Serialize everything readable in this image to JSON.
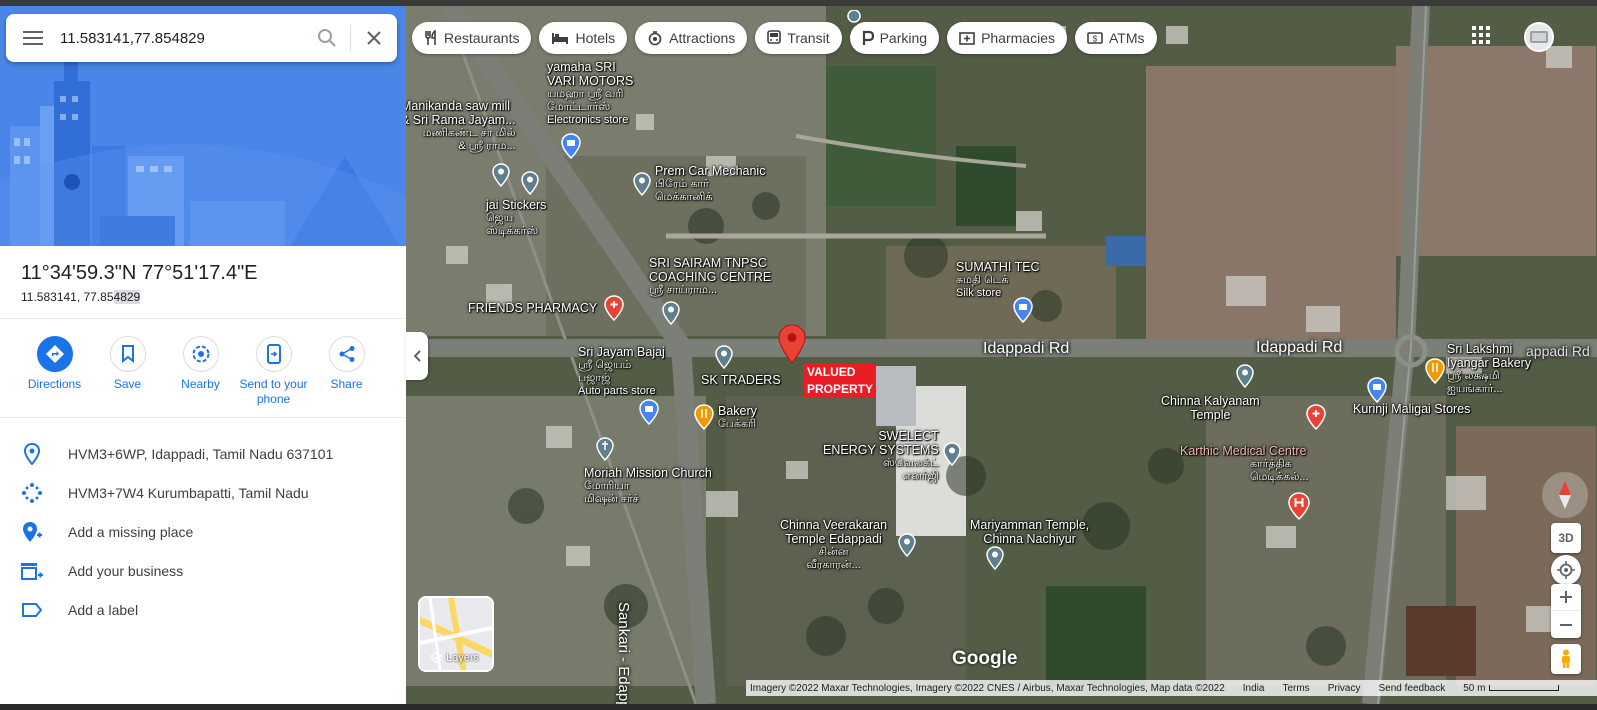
{
  "search": {
    "value": "11.583141,77.854829"
  },
  "place": {
    "dms": "11°34'59.3\"N 77°51'17.4\"E",
    "decimal_plain": "11.583141, 77.85",
    "decimal_highlight": "4829"
  },
  "actions": [
    {
      "label": "Directions",
      "icon": "directions-icon"
    },
    {
      "label": "Save",
      "icon": "bookmark-icon"
    },
    {
      "label": "Nearby",
      "icon": "nearby-icon"
    },
    {
      "label": "Send to your phone",
      "icon": "phone-icon"
    },
    {
      "label": "Share",
      "icon": "share-icon"
    }
  ],
  "info_rows": [
    {
      "text": "HVM3+6WP, Idappadi, Tamil Nadu 637101",
      "icon": "location-pin-icon"
    },
    {
      "text": "HVM3+7W4 Kurumbapatti, Tamil Nadu",
      "icon": "plus-code-icon"
    },
    {
      "text": "Add a missing place",
      "icon": "add-place-icon"
    },
    {
      "text": "Add your business",
      "icon": "add-business-icon"
    },
    {
      "text": "Add a label",
      "icon": "label-icon"
    }
  ],
  "chips": [
    {
      "label": "Restaurants",
      "icon": "fork-knife-icon"
    },
    {
      "label": "Hotels",
      "icon": "bed-icon"
    },
    {
      "label": "Attractions",
      "icon": "attraction-icon"
    },
    {
      "label": "Transit",
      "icon": "bus-icon"
    },
    {
      "label": "Parking",
      "icon": "parking-icon"
    },
    {
      "label": "Pharmacies",
      "icon": "pharmacy-icon"
    },
    {
      "label": "ATMs",
      "icon": "atm-icon"
    }
  ],
  "map_labels": {
    "yamaha": {
      "name": "yamaha SRI\nVARI MOTORS",
      "tamil": "யமஹா ஸ்ரீ வரி\nமோட்டார்ஸ்",
      "type": "Electronics store"
    },
    "manikanda": {
      "name": "Manikanda saw mill\n& Sri Rama Jayam...",
      "tamil": "மணிகண்ட சா மில்\n& ஸ்ரீ ராம..."
    },
    "prem": {
      "name": "Prem Car Mechanic",
      "tamil": "பிரேம் கார்\nமெக்கானிக்"
    },
    "jai": {
      "name": "jai Stickers",
      "tamil": "ஜெய\nஸ்டிக்கர்ஸ்"
    },
    "sairam": {
      "name": "SRI SAIRAM TNPSC\nCOACHING CENTRE",
      "tamil": "ஸ்ரீ சாய்ராம..."
    },
    "friends": {
      "name": "FRIENDS PHARMACY"
    },
    "sumathi": {
      "name": "SUMATHI TEC",
      "tamil": "சுமதி டெக்",
      "type": "Silk store"
    },
    "bajaj": {
      "name": "Sri Jayam Bajaj",
      "tamil": "ஸ்ரீ ஜெயம்\nபஜாஜ்",
      "type": "Auto parts store"
    },
    "sk": {
      "name": "SK TRADERS"
    },
    "bakery": {
      "name": "Bakery",
      "tamil": "பேக்கரி"
    },
    "moriah": {
      "name": "Moriah Mission Church",
      "tamil": "மோரியா\nமிஷன் சர்ச்"
    },
    "swelect": {
      "name": "SWELECT\nENERGY SYSTEMS",
      "tamil": "ஸ்வெலக்ட்\nஎனர்ஜி"
    },
    "veerakaran": {
      "name": "Chinna Veerakaran\nTemple Edappadi",
      "tamil": "சின்ன\nவீரகாரன்..."
    },
    "mariyamman": {
      "name": "Mariyamman Temple,\nChinna Nachiyur"
    },
    "kalyanam": {
      "name": "Chinna Kalyanam\nTemple"
    },
    "karthic": {
      "name": "Karthic Medical Centre",
      "tamil": "கார்த்திக\nமெடிக்கல்..."
    },
    "kurinji": {
      "name": "Kurinji Maligai Stores"
    },
    "lakshmi": {
      "name": "Sri Lakshmi\nIyangar Bakery",
      "tamil": "ஸ்ரீ லக்ஷ்மி\nஐயங்கார்..."
    }
  },
  "roads": {
    "idappadi1": "Idappadi Rd",
    "idappadi2": "Idappadi Rd",
    "sankari": "Sankari - Edappadi",
    "partial": "appadi Rd"
  },
  "marker_label": "VALUED\nPROPERTY",
  "layers_label": "Layers",
  "controls": {
    "three_d": "3D"
  },
  "brand": "Google",
  "footer": {
    "attribution": "Imagery ©2022 Maxar Technologies, Imagery ©2022 CNES / Airbus, Maxar Technologies, Map data ©2022",
    "links": [
      "India",
      "Terms",
      "Privacy",
      "Send feedback"
    ],
    "scale": "50 m"
  },
  "colors": {
    "accent": "#1a73e8",
    "marker": "#ea4335",
    "valued_bg": "#ea1c24",
    "hero": "#4a86e8"
  }
}
